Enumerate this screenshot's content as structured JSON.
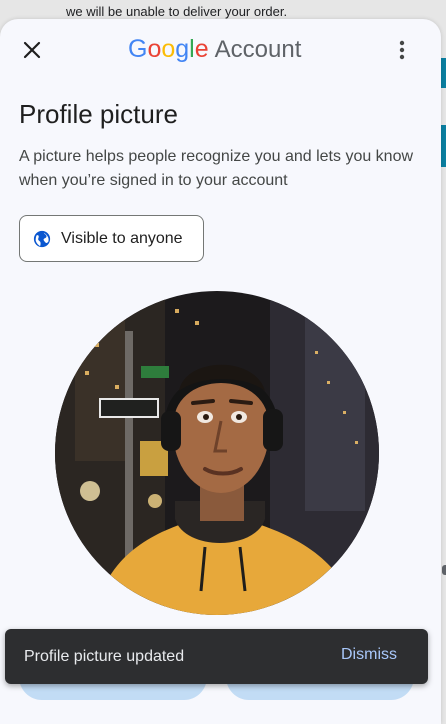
{
  "background": {
    "notice_text": "we will be unable to deliver your order."
  },
  "header": {
    "close_icon": "close-icon",
    "logo": {
      "letters": [
        "G",
        "o",
        "o",
        "g",
        "l",
        "e"
      ],
      "product": "Account"
    },
    "menu_icon": "more-vert-icon"
  },
  "main": {
    "title": "Profile picture",
    "description": "A picture helps people recognize you and lets you know when you’re signed in to your account",
    "visibility": {
      "icon": "globe-icon",
      "label": "Visible to anyone"
    },
    "photo_alt": "profile-photo"
  },
  "snackbar": {
    "message": "Profile picture updated",
    "action": "Dismiss"
  },
  "colors": {
    "accent": "#0b57d0",
    "google_blue": "#4285f4",
    "google_red": "#ea4335",
    "google_yellow": "#fbbc05",
    "google_green": "#34a853",
    "snackbar_bg": "#2d2e30",
    "snackbar_action": "#a8c7fa"
  }
}
